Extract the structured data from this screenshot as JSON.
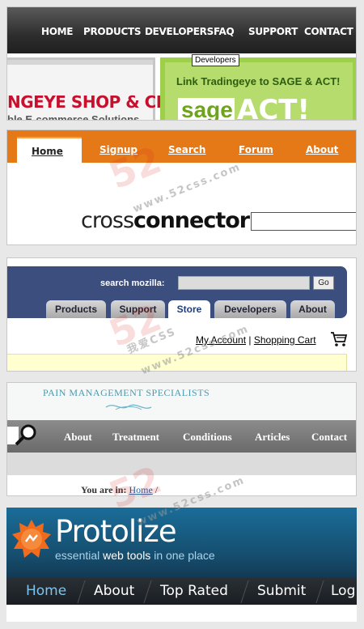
{
  "card1": {
    "nav": [
      "HOME",
      "PRODUCTS",
      "DEVELOPERS",
      "FAQ",
      "SUPPORT",
      "CONTACT"
    ],
    "tooltip": "Developers",
    "shop_title": "NGEYE SHOP & CMS",
    "shop_subtitle": "ble E-commerce Solutions",
    "sage_title": "Link Tradingeye to SAGE & ACT!",
    "sage_logo": "sage",
    "act_logo": "ACT!",
    "colors": {
      "nav_bg": "#2e2e2e",
      "shop_red": "#c8102e",
      "sage_green": "#9ecf4b"
    }
  },
  "card2": {
    "tabs": [
      "Home",
      "Signup",
      "Search",
      "Forum",
      "About"
    ],
    "logo_light": "cross",
    "logo_bold": "connector",
    "colors": {
      "bar": "#e57817"
    }
  },
  "card3": {
    "search_label": "search mozilla:",
    "go_label": "Go",
    "tabs": [
      "Products",
      "Support",
      "Store",
      "Developers",
      "About"
    ],
    "selected_tab": "Store",
    "my_account": "My Account",
    "separator": "|",
    "shopping_cart": "Shopping Cart",
    "colors": {
      "header": "#3c4e7e",
      "notice": "#ffffd0"
    }
  },
  "card4": {
    "title": "PAIN MANAGEMENT SPECIALISTS",
    "nav": [
      "About",
      "Treatment",
      "Conditions",
      "Articles",
      "Contact"
    ],
    "you_are_in": "You are in:",
    "crumb_home": "Home",
    "crumb_sep": "/"
  },
  "card5": {
    "brand": "Protolize",
    "tag_pre": "essential",
    "tag_bold": "web tools",
    "tag_post": "in one place",
    "nav": [
      "Home",
      "About",
      "Top Rated",
      "Submit",
      "Log"
    ],
    "selected": "Home",
    "colors": {
      "header": "#1a6d99",
      "nav_bg": "#1a1e22",
      "selected": "#7ec3ee"
    }
  },
  "watermark": {
    "big": "52",
    "small": "www.52css.com",
    "cjk": "我爱CSS"
  }
}
